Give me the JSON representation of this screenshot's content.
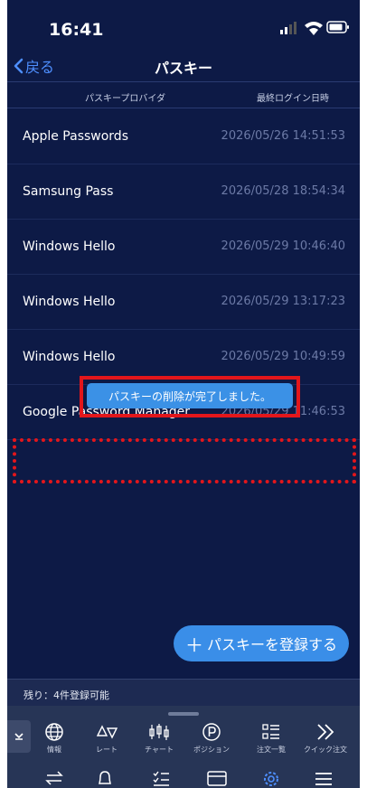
{
  "status_bar": {
    "time": "16:41"
  },
  "nav": {
    "back_label": "戻る",
    "title": "パスキー"
  },
  "table": {
    "col_provider": "パスキープロバイダ",
    "col_last_login": "最終ログイン日時",
    "rows": [
      {
        "provider": "Apple Passwords",
        "last_login": "2026/05/26 14:51:53"
      },
      {
        "provider": "Samsung Pass",
        "last_login": "2026/05/28 18:54:34"
      },
      {
        "provider": "Windows Hello",
        "last_login": "2026/05/29 10:46:40"
      },
      {
        "provider": "Windows Hello",
        "last_login": "2026/05/29 13:17:23"
      },
      {
        "provider": "Windows Hello",
        "last_login": "2026/05/29 10:49:59"
      },
      {
        "provider": "Google Password Manager",
        "last_login": "2026/05/29 11:46:53"
      }
    ]
  },
  "toast": {
    "message": "パスキーの削除が完了しました。"
  },
  "register_button": {
    "plus": "＋",
    "label": "パスキーを登録する"
  },
  "remaining": {
    "text": "残り：4件登録可能"
  },
  "tabs": [
    {
      "label": "情報",
      "icon": "globe-icon"
    },
    {
      "label": "レート",
      "icon": "rate-icon"
    },
    {
      "label": "チャート",
      "icon": "chart-icon"
    },
    {
      "label": "ポジション",
      "icon": "position-icon"
    },
    {
      "label": "注文一覧",
      "icon": "order-list-icon"
    },
    {
      "label": "クイック注文",
      "icon": "quick-order-icon"
    }
  ],
  "colors": {
    "background": "#0d1a46",
    "accent": "#3a8ee8",
    "highlight": "#e3161b",
    "link": "#4e8fff"
  }
}
